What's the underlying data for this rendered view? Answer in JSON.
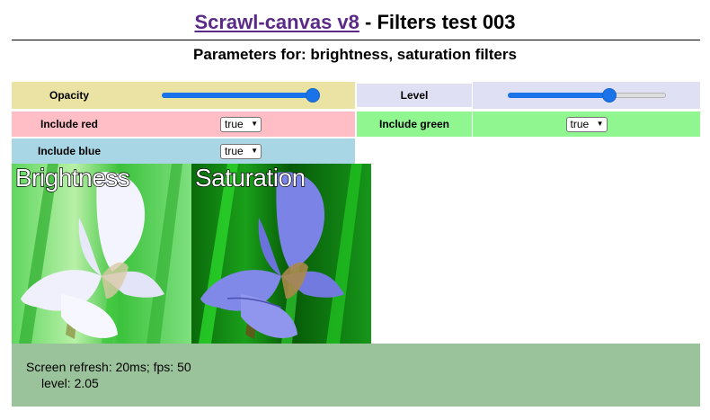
{
  "header": {
    "link_text": "Scrawl-canvas v8",
    "title_rest": " - Filters test 003",
    "subtitle": "Parameters for: brightness, saturation filters"
  },
  "controls": {
    "opacity": {
      "label": "Opacity",
      "value": 1.0,
      "min": 0,
      "max": 1
    },
    "level": {
      "label": "Level",
      "value": 0.66,
      "min": 0,
      "max": 1
    },
    "include_red": {
      "label": "Include red",
      "selected": "true"
    },
    "include_green": {
      "label": "Include green",
      "selected": "true"
    },
    "include_blue": {
      "label": "Include blue",
      "selected": "true"
    }
  },
  "canvas": {
    "panels": [
      {
        "label": "Brightness"
      },
      {
        "label": "Saturation"
      }
    ]
  },
  "status": {
    "refresh": "Screen refresh: 20ms; fps: 50",
    "level": "level: 2.05"
  },
  "colors": {
    "opacity_bg": "#ebe3a3",
    "level_bg": "#e0e0f5",
    "red_bg": "#ffbdc6",
    "green_bg": "#90f690",
    "blue_bg": "#a9d6e4",
    "status_bg": "#9bc39b",
    "link": "#5b2a86",
    "slider_accent": "#1a73e8"
  },
  "icons": {
    "select_arrow": "chevron-down-icon"
  }
}
